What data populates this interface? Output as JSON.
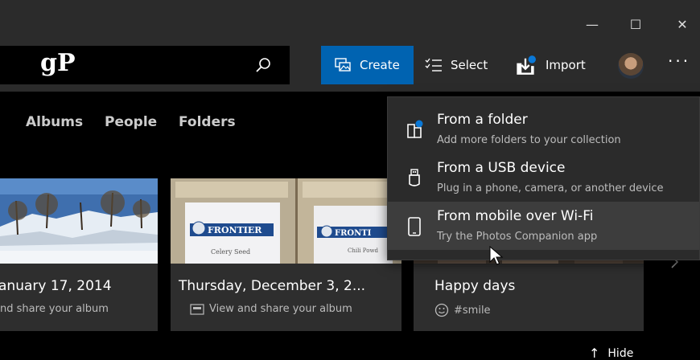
{
  "window": {
    "minimize_glyph": "—",
    "maximize_glyph": "☐",
    "close_glyph": "✕"
  },
  "search": {
    "logo": "gP",
    "icon": "search-icon"
  },
  "toolbar": {
    "create_label": "Create",
    "select_label": "Select",
    "import_label": "Import",
    "more_glyph": "···",
    "accent_color": "#0063b1"
  },
  "nav": {
    "tabs": [
      {
        "label": "Albums"
      },
      {
        "label": "People"
      },
      {
        "label": "Folders"
      }
    ]
  },
  "albums": [
    {
      "title": "anuary 17, 2014",
      "subtitle": "nd share your album"
    },
    {
      "title": "Thursday, December 3, 2...",
      "subtitle": "View and share your album",
      "icon": "slideshow-icon"
    },
    {
      "title": "Happy days",
      "subtitle": "#smile",
      "icon": "smiley-icon"
    }
  ],
  "thumbnail_text": {
    "brand": "FRONTIER",
    "brand_short": "FRONTI",
    "label_a": "Celery Seed",
    "label_b": "Chili Powd"
  },
  "import_menu": {
    "items": [
      {
        "label": "From a folder",
        "description": "Add more folders to your collection",
        "icon": "folder-icon"
      },
      {
        "label": "From a USB device",
        "description": "Plug in a phone, camera, or another device",
        "icon": "usb-icon"
      },
      {
        "label": "From mobile over Wi-Fi",
        "description": "Try the Photos Companion app",
        "icon": "phone-icon"
      }
    ]
  },
  "footer": {
    "hide_label": "Hide",
    "hide_glyph": "↑"
  }
}
